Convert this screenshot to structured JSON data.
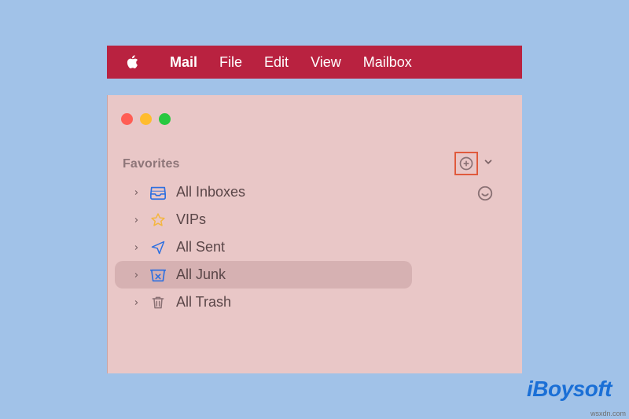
{
  "menubar": {
    "app": "Mail",
    "items": [
      "File",
      "Edit",
      "View",
      "Mailbox"
    ]
  },
  "sidebar": {
    "section_title": "Favorites",
    "items": [
      {
        "label": "All Inboxes",
        "icon": "inbox-icon",
        "selected": false
      },
      {
        "label": "VIPs",
        "icon": "star-icon",
        "selected": false
      },
      {
        "label": "All Sent",
        "icon": "send-icon",
        "selected": false
      },
      {
        "label": "All Junk",
        "icon": "junk-icon",
        "selected": true
      },
      {
        "label": "All Trash",
        "icon": "trash-icon",
        "selected": false
      }
    ]
  },
  "colors": {
    "menubar_bg": "#b92240",
    "window_bg": "#e9c7c7",
    "page_bg": "#a1c2e8",
    "selection_bg": "#d6b1b2",
    "icon_blue": "#2d6fe0",
    "icon_star": "#f4b63f",
    "icon_muted": "#8a7174",
    "highlight_border": "#e05a3c"
  },
  "watermark": {
    "brand": "iBoysoft",
    "source": "wsxdn.com"
  }
}
